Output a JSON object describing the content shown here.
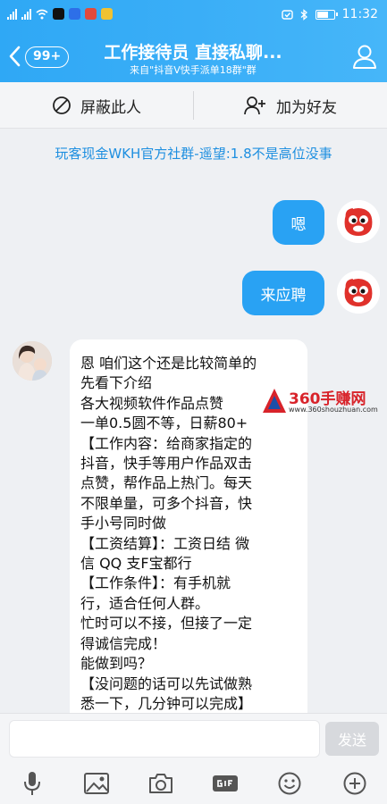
{
  "status_bar": {
    "time": "11:32",
    "icons": [
      "signal-icon",
      "wifi-icon",
      "tiktok-icon",
      "app-icon",
      "app-icon",
      "app-icon",
      "alarm-icon",
      "bluetooth-icon",
      "battery-icon"
    ]
  },
  "header": {
    "unread_badge": "99+",
    "title": "工作接待员 直接私聊...",
    "subtitle": "来自\"抖音V快手派单18群\"群"
  },
  "actions": {
    "block_label": "屏蔽此人",
    "add_friend_label": "加为好友"
  },
  "banner": {
    "text": "玩客现金WKH官方社群-遥望:1.8不是高位没事"
  },
  "messages": [
    {
      "side": "right",
      "text": "嗯"
    },
    {
      "side": "right",
      "text": "来应聘"
    },
    {
      "side": "left",
      "lines": [
        "恩 咱们这个还是比较简单的",
        "先看下介绍",
        "各大视频软件作品点赞",
        "一单0.5圆不等，日薪80+",
        "【工作内容：给商家指定的",
        "抖音，快手等用户作品双击",
        "点赞，帮作品上热门。每天",
        "不限单量，可多个抖音，快",
        "手小号同时做",
        "【工资结算】：工资日结 微",
        "信 QQ 支F宝都行",
        "【工作条件】：有手机就",
        "行，适合任何人群。",
        "忙时可以不接，但接了一定",
        "得诚信完成！",
        "能做到吗？",
        "【没问题的话可以先试做熟",
        "悉一下，几分钟可以完成】"
      ]
    }
  ],
  "watermark": {
    "name": "360手赚网",
    "url": "www.360shouzhuan.com"
  },
  "input": {
    "placeholder": "",
    "send_label": "发送"
  },
  "toolbar": {
    "icons": [
      "microphone-icon",
      "image-icon",
      "camera-icon",
      "gif-icon",
      "emoji-icon",
      "plus-icon"
    ]
  },
  "colors": {
    "header_blue": "#2fa8f5",
    "bubble_blue": "#29a2f3",
    "banner_text": "#1e8fe0",
    "watermark_red": "#d8232a"
  }
}
